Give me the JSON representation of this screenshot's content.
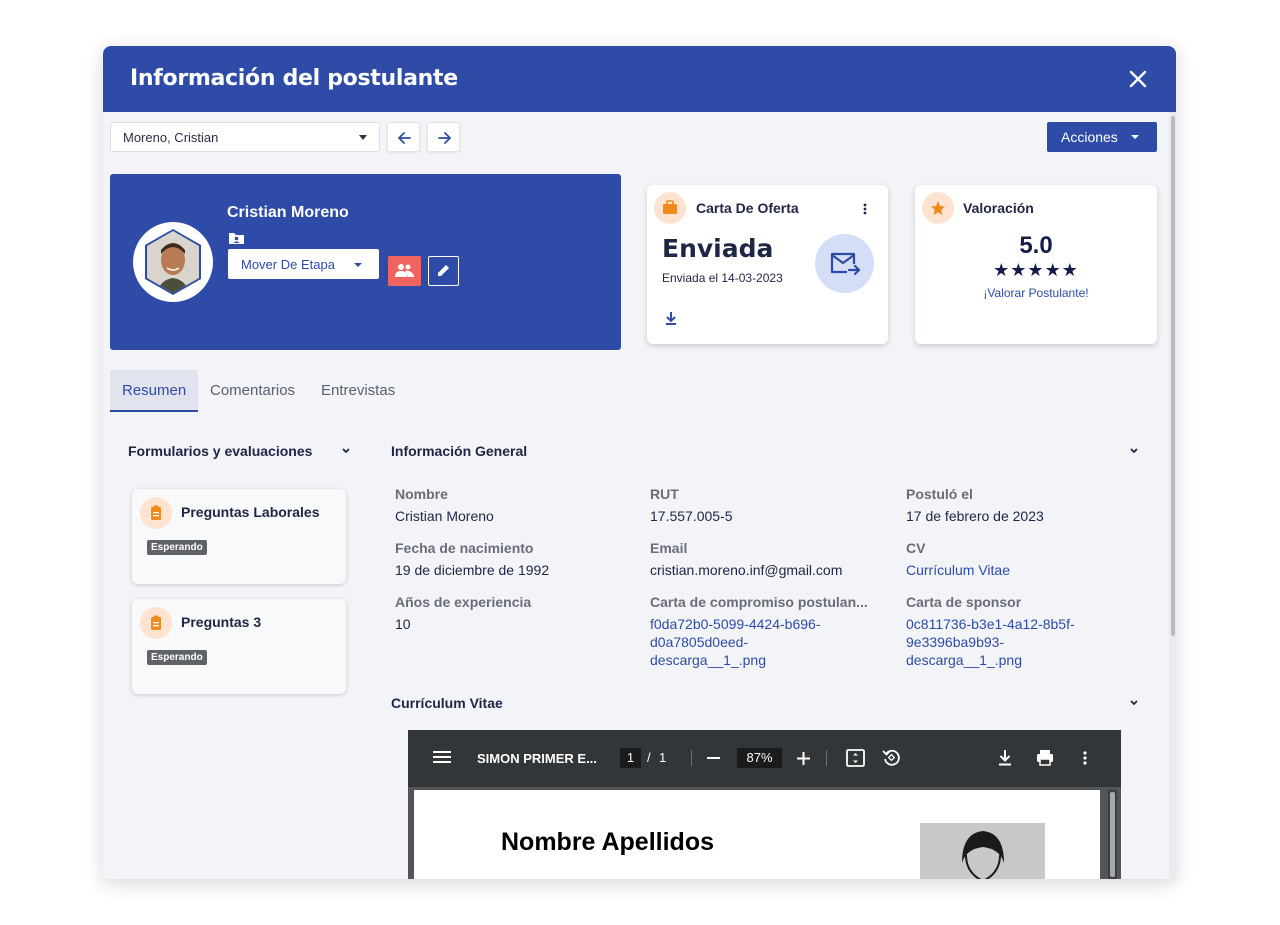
{
  "modal": {
    "title": "Información del postulante"
  },
  "toolbar": {
    "candidate_select": "Moreno, Cristian",
    "actions_label": "Acciones"
  },
  "profile": {
    "name": "Cristian Moreno",
    "move_stage_label": "Mover De Etapa"
  },
  "offer_card": {
    "title": "Carta De Oferta",
    "status": "Enviada",
    "sent_date": "Enviada el 14-03-2023"
  },
  "rating_card": {
    "title": "Valoración",
    "score": "5.0",
    "stars": "★★★★★",
    "rate_link": "¡Valorar Postulante!"
  },
  "tabs": [
    {
      "label": "Resumen",
      "active": true
    },
    {
      "label": "Comentarios",
      "active": false
    },
    {
      "label": "Entrevistas",
      "active": false
    }
  ],
  "forms_section": {
    "title": "Formularios y evaluaciones",
    "items": [
      {
        "title": "Preguntas Laborales",
        "status": "Esperando"
      },
      {
        "title": "Preguntas 3",
        "status": "Esperando"
      }
    ]
  },
  "general_info": {
    "title": "Información General",
    "fields": {
      "nombre": {
        "label": "Nombre",
        "value": "Cristian Moreno"
      },
      "rut": {
        "label": "RUT",
        "value": "17.557.005-5"
      },
      "postulo": {
        "label": "Postuló el",
        "value": "17 de febrero de 2023"
      },
      "nacimiento": {
        "label": "Fecha de nacimiento",
        "value": "19 de diciembre de 1992"
      },
      "email": {
        "label": "Email",
        "value": "cristian.moreno.inf@gmail.com"
      },
      "cv": {
        "label": "CV",
        "value": "Currículum Vitae"
      },
      "experiencia": {
        "label": "Años de experiencia",
        "value": "10"
      },
      "compromiso": {
        "label": "Carta de compromiso postulan...",
        "value_lines": [
          "f0da72b0-5099-4424-b696-",
          "d0a7805d0eed-",
          "descarga__1_.png"
        ]
      },
      "sponsor": {
        "label": "Carta de sponsor",
        "value_lines": [
          "0c811736-b3e1-4a12-8b5f-",
          "9e3396ba9b93-",
          "descarga__1_.png"
        ]
      }
    }
  },
  "cv_section": {
    "title": "Currículum Vitae",
    "pdf": {
      "title": "SIMON PRIMER E...",
      "page": "1",
      "separator": "/",
      "total_pages": "1",
      "zoom": "87%",
      "heading": "Nombre Apellidos"
    }
  },
  "colors": {
    "primary": "#2e4ba8",
    "danger": "#ef6461",
    "badge_bg": "#fde3d0",
    "accent_orange": "#f08a1c"
  }
}
